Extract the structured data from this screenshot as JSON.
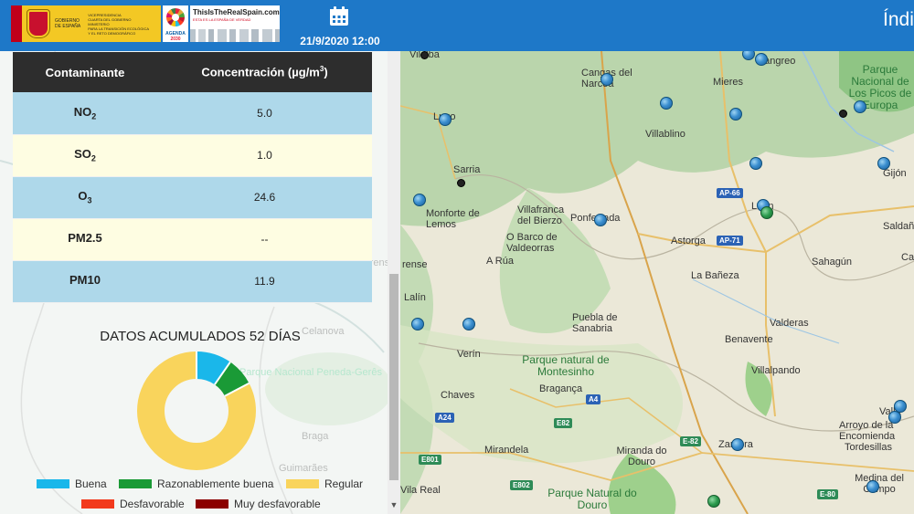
{
  "header": {
    "date_time": "21/9/2020 12:00",
    "title_partial": "Índi",
    "accent_color": "#1e78c8",
    "logos": {
      "government": {
        "gobierno_lines": [
          "GOBIERNO",
          "DE ESPAÑA"
        ],
        "ministry_lines": [
          "VICEPRESIDENCIA",
          "CUARTA DEL GOBIERNO",
          "MINISTERIO",
          "PARA LA TRANSICIÓN ECOLÓGICA",
          "Y EL RETO DEMOGRÁFICO"
        ]
      },
      "agenda": {
        "line1": "AGENDA",
        "line2": "2030"
      },
      "real_spain": {
        "title": "ThisIsTheRealSpain.com",
        "subtitle": "ESTA ES LA ESPAÑA DE VERDAD"
      }
    }
  },
  "table": {
    "headers": {
      "pollutant": "Contaminante",
      "concentration": "Concentración (µg/m",
      "concentration_sup": "3",
      "concentration_end": ")"
    },
    "rows": [
      {
        "base": "NO",
        "sub": "2",
        "value": "5.0"
      },
      {
        "base": "SO",
        "sub": "2",
        "value": "1.0"
      },
      {
        "base": "O",
        "sub": "3",
        "value": "24.6"
      },
      {
        "base": "PM2.5",
        "sub": "",
        "value": "--"
      },
      {
        "base": "PM10",
        "sub": "",
        "value": "11.9"
      }
    ]
  },
  "accumulated": {
    "title": "DATOS ACUMULADOS 52 DÍAS",
    "chart_data": {
      "type": "pie",
      "title": "DATOS ACUMULADOS 52 DÍAS",
      "categories": [
        "Buena",
        "Razonablemente buena",
        "Regular",
        "Desfavorable",
        "Muy desfavorable"
      ],
      "values": [
        5,
        4,
        43,
        0,
        0
      ],
      "colors": [
        "#1ab7ea",
        "#1a9a36",
        "#f9d45c",
        "#f23a1d",
        "#8b0000"
      ],
      "donut": true
    },
    "legend": [
      {
        "label": "Buena",
        "color": "#1ab7ea"
      },
      {
        "label": "Razonablemente buena",
        "color": "#1a9a36"
      },
      {
        "label": "Regular",
        "color": "#f9d45c"
      },
      {
        "label": "Desfavorable",
        "color": "#f23a1d"
      },
      {
        "label": "Muy desfavorable",
        "color": "#8b0000"
      }
    ]
  },
  "map": {
    "places": [
      "Vilalba",
      "Cangas del Narcea",
      "Mieres",
      "Langreo",
      "Lugo",
      "Villablino",
      "Sarria",
      "Monforte de Lemos",
      "Villafranca del Bierzo",
      "O Barco de Valdeorras",
      "Ponferrada",
      "León",
      "Astorga",
      "Sahagún",
      "La Bañeza",
      "A Rúa",
      "Puebla de Sanabria",
      "Valderas",
      "Benavente",
      "Verín",
      "Chaves",
      "Bragança",
      "Villalpando",
      "Arroyo de la Encomienda",
      "Tordesillas",
      "Zamora",
      "Mirandela",
      "Miranda do Douro",
      "Medina del Campo",
      "Vila Real",
      "Valla",
      "Gijón"
    ],
    "parks": [
      "Parque Nacional de Los Picos de Europa",
      "Parque natural de Montesinho",
      "Parque Natural do Douro"
    ],
    "bg_parks": [
      "Parque Nacional Peneda-Gerês"
    ],
    "bg_places": [
      "Braga",
      "Guimarães",
      "Ourense",
      "Celanova"
    ],
    "roads": [
      "AP-66",
      "AP-71",
      "A4",
      "E82",
      "E-82",
      "A24",
      "E801",
      "E802",
      "E-80"
    ],
    "left_fragments": [
      "Lalín",
      "rense",
      "Celanova"
    ],
    "right_fragments": [
      "Saldañ",
      "Ca",
      "Valla"
    ]
  }
}
